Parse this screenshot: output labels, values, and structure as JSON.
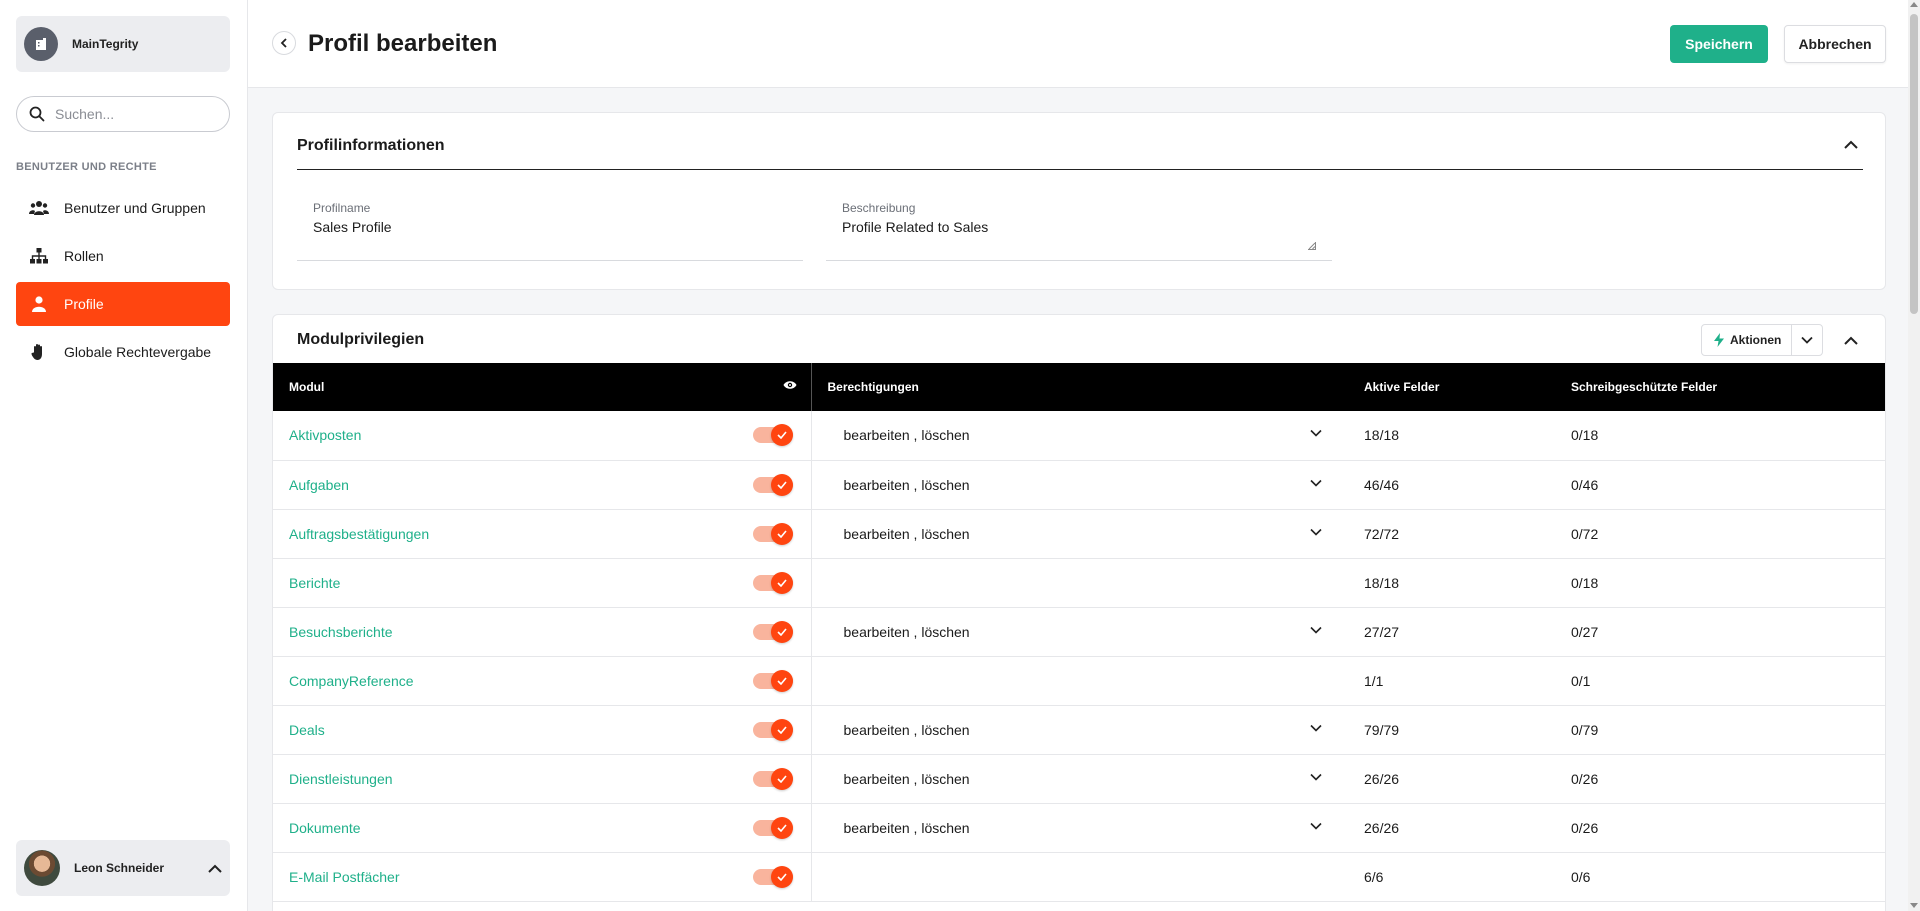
{
  "app": {
    "org_name": "MainTegrity"
  },
  "search": {
    "placeholder": "Suchen..."
  },
  "sidebar": {
    "section_label": "BENUTZER UND RECHTE",
    "items": [
      {
        "label": "Benutzer und Gruppen",
        "icon": "users-icon",
        "active": false
      },
      {
        "label": "Rollen",
        "icon": "hierarchy-icon",
        "active": false
      },
      {
        "label": "Profile",
        "icon": "person-icon",
        "active": true
      },
      {
        "label": "Globale Rechtevergabe",
        "icon": "hand-icon",
        "active": false
      }
    ],
    "user_name": "Leon Schneider"
  },
  "header": {
    "title": "Profil bearbeiten",
    "save_label": "Speichern",
    "cancel_label": "Abbrechen"
  },
  "profile_info": {
    "title": "Profilinformationen",
    "name_label": "Profilname",
    "name_value": "Sales Profile",
    "desc_label": "Beschreibung",
    "desc_value": "Profile Related to Sales"
  },
  "modules": {
    "title": "Modulprivilegien",
    "actions_label": "Aktionen",
    "columns": {
      "module": "Modul",
      "permissions": "Berechtigungen",
      "active_fields": "Aktive Felder",
      "readonly_fields": "Schreibgeschützte Felder"
    },
    "rows": [
      {
        "name": "Aktivposten",
        "enabled": true,
        "permissions": "bearbeiten , löschen",
        "active": "18/18",
        "readonly": "0/18"
      },
      {
        "name": "Aufgaben",
        "enabled": true,
        "permissions": "bearbeiten , löschen",
        "active": "46/46",
        "readonly": "0/46"
      },
      {
        "name": "Auftragsbestätigungen",
        "enabled": true,
        "permissions": "bearbeiten , löschen",
        "active": "72/72",
        "readonly": "0/72"
      },
      {
        "name": "Berichte",
        "enabled": true,
        "permissions": "",
        "active": "18/18",
        "readonly": "0/18"
      },
      {
        "name": "Besuchsberichte",
        "enabled": true,
        "permissions": "bearbeiten , löschen",
        "active": "27/27",
        "readonly": "0/27"
      },
      {
        "name": "CompanyReference",
        "enabled": true,
        "permissions": "",
        "active": "1/1",
        "readonly": "0/1"
      },
      {
        "name": "Deals",
        "enabled": true,
        "permissions": "bearbeiten , löschen",
        "active": "79/79",
        "readonly": "0/79"
      },
      {
        "name": "Dienstleistungen",
        "enabled": true,
        "permissions": "bearbeiten , löschen",
        "active": "26/26",
        "readonly": "0/26"
      },
      {
        "name": "Dokumente",
        "enabled": true,
        "permissions": "bearbeiten , löschen",
        "active": "26/26",
        "readonly": "0/26"
      },
      {
        "name": "E-Mail Postfächer",
        "enabled": true,
        "permissions": "",
        "active": "6/6",
        "readonly": "0/6"
      }
    ]
  },
  "colors": {
    "accent": "#ff4510",
    "primary": "#1fb08a",
    "header_bg": "#000000"
  }
}
